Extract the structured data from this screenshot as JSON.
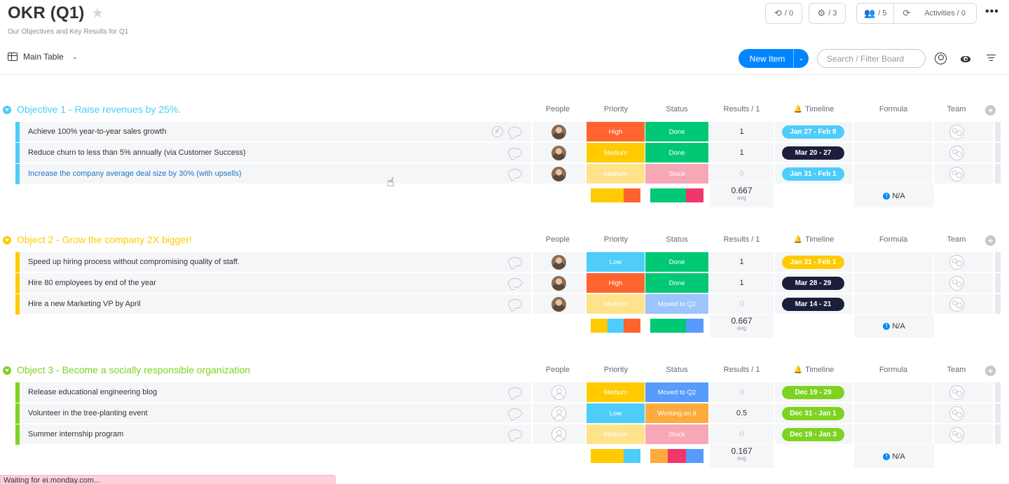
{
  "board": {
    "title": "OKR (Q1)",
    "description": "Our Objectives and Key Results for Q1"
  },
  "header_pills": {
    "updates": "/ 0",
    "integrations": "/ 3",
    "members": "/ 5",
    "activities": "Activities / 0"
  },
  "toolbar": {
    "view_label": "Main Table",
    "new_item_label": "New Item",
    "search_placeholder": "Search / Filter Board"
  },
  "columns": {
    "people": "People",
    "priority": "Priority",
    "status": "Status",
    "results": "Results / 1",
    "timeline": "Timeline",
    "formula": "Formula",
    "team": "Team"
  },
  "colors": {
    "high": "#ff642e",
    "medium": "#ffcb00",
    "medium_faded": "#ffe38a",
    "low": "#4eccfa",
    "done": "#00c875",
    "stuck": "#f598a9",
    "stuck_faded": "#f7a7b6",
    "moved_to_q2": "#579bfc",
    "moved_to_q2_faded": "#9cc4fd",
    "working_on_it": "#fdab3d",
    "timeline_dark": "#1c1f3b",
    "group1": "#4eccfa",
    "group2": "#ffcb00",
    "group3": "#7ed321"
  },
  "groups": [
    {
      "title": "Objective 1 - Raise revenues by 25%.",
      "color": "#4eccfa",
      "items": [
        {
          "name": "Achieve 100% year-to-year sales growth",
          "avatar": true,
          "priority": "High",
          "priority_color": "#ff642e",
          "status": "Done",
          "status_color": "#00c875",
          "results": "1",
          "timeline": "Jan 27 - Feb 8",
          "timeline_color": "#4eccfa"
        },
        {
          "name": "Reduce churn to less than 5% annually (via Customer Success)",
          "avatar": true,
          "priority": "Medium",
          "priority_color": "#ffcb00",
          "status": "Done",
          "status_color": "#00c875",
          "results": "1",
          "timeline": "Mar 20 - 27",
          "timeline_color": "#1c1f3b"
        },
        {
          "name": "Increase the company average deal size by 30% (with upsells)",
          "avatar": true,
          "priority": "Medium",
          "priority_color": "#ffe38a",
          "status": "Stuck",
          "status_color": "#f7a7b6",
          "results": "0",
          "timeline": "Jan 31 - Feb 1",
          "timeline_color": "#4eccfa"
        }
      ],
      "summary": {
        "results": "0.667",
        "avg": "avg",
        "formula": "N/A",
        "priority_bar": [
          {
            "color": "#ffcb00",
            "fraction": 0.667
          },
          {
            "color": "#ff642e",
            "fraction": 0.333
          }
        ],
        "status_bar": [
          {
            "color": "#00c875",
            "fraction": 0.667
          },
          {
            "color": "#f0366a",
            "fraction": 0.333
          }
        ]
      }
    },
    {
      "title": "Object 2 - Grow the company 2X bigger!",
      "color": "#ffcb00",
      "items": [
        {
          "name": "Speed up hiring process without compromising quality of staff.",
          "avatar": true,
          "priority": "Low",
          "priority_color": "#4eccfa",
          "status": "Done",
          "status_color": "#00c875",
          "results": "1",
          "timeline": "Jan 31 - Feb 1",
          "timeline_color": "#ffcb00"
        },
        {
          "name": "Hire 80 employees by end of the year",
          "avatar": true,
          "priority": "High",
          "priority_color": "#ff642e",
          "status": "Done",
          "status_color": "#00c875",
          "results": "1",
          "timeline": "Mar 28 - 29",
          "timeline_color": "#1c1f3b"
        },
        {
          "name": "Hire a new Marketing VP by April",
          "avatar": true,
          "priority": "Medium",
          "priority_color": "#ffe38a",
          "status": "Moved to Q2",
          "status_color": "#9cc4fd",
          "results": "0",
          "timeline": "Mar 14 - 21",
          "timeline_color": "#1c1f3b"
        }
      ],
      "summary": {
        "results": "0.667",
        "avg": "avg",
        "formula": "N/A",
        "priority_bar": [
          {
            "color": "#ffcb00",
            "fraction": 0.333
          },
          {
            "color": "#4eccfa",
            "fraction": 0.333
          },
          {
            "color": "#ff642e",
            "fraction": 0.334
          }
        ],
        "status_bar": [
          {
            "color": "#00c875",
            "fraction": 0.667
          },
          {
            "color": "#579bfc",
            "fraction": 0.333
          }
        ]
      }
    },
    {
      "title": "Object 3 - Become a socially responsible organization",
      "color": "#7ed321",
      "items": [
        {
          "name": "Release educational engineering blog",
          "avatar": false,
          "priority": "Medium",
          "priority_color": "#ffcb00",
          "status": "Moved to Q2",
          "status_color": "#579bfc",
          "results": "0",
          "timeline": "Dec 19 - 29",
          "timeline_color": "#7ed321"
        },
        {
          "name": "Volunteer in the tree-planting event",
          "avatar": false,
          "priority": "Low",
          "priority_color": "#4eccfa",
          "status": "Working on it",
          "status_color": "#fdab3d",
          "results": "0.5",
          "timeline": "Dec 31 - Jan 1",
          "timeline_color": "#7ed321"
        },
        {
          "name": "Summer internship program",
          "avatar": false,
          "priority": "Medium",
          "priority_color": "#ffe38a",
          "status": "Stuck",
          "status_color": "#f7a7b6",
          "results": "0",
          "timeline": "Dec 19 - Jan 3",
          "timeline_color": "#7ed321"
        }
      ],
      "summary": {
        "results": "0.167",
        "avg": "avg",
        "formula": "N/A",
        "priority_bar": [
          {
            "color": "#ffcb00",
            "fraction": 0.667
          },
          {
            "color": "#4eccfa",
            "fraction": 0.333
          }
        ],
        "status_bar": [
          {
            "color": "#fdab3d",
            "fraction": 0.333
          },
          {
            "color": "#f0366a",
            "fraction": 0.333
          },
          {
            "color": "#579bfc",
            "fraction": 0.334
          }
        ]
      }
    }
  ],
  "browser_status": "Waiting for ei.monday.com..."
}
